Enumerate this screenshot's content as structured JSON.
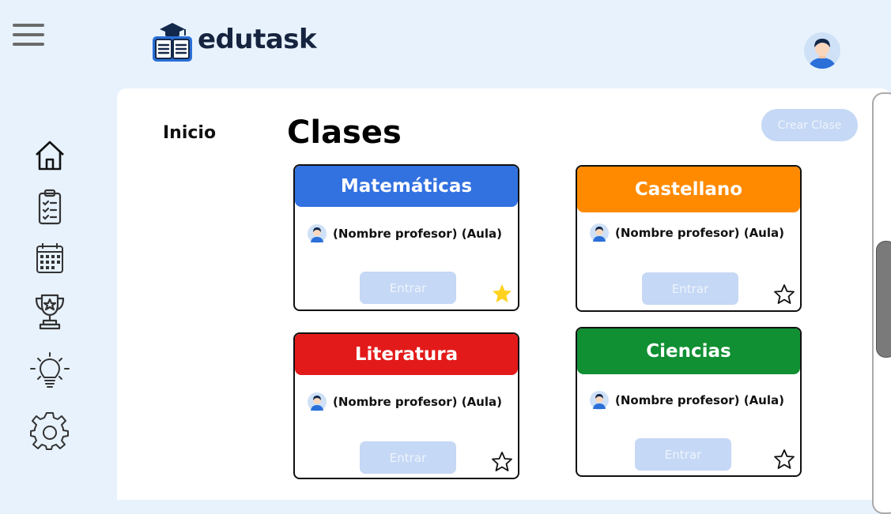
{
  "header": {
    "brand": "edutask",
    "menu_icon": "hamburger-icon",
    "logo_icon": "book-graduation-cap-icon",
    "avatar_icon": "user-avatar-icon"
  },
  "sidebar": {
    "items": [
      {
        "icon": "home-icon"
      },
      {
        "icon": "clipboard-checklist-icon"
      },
      {
        "icon": "calendar-icon"
      },
      {
        "icon": "trophy-icon"
      },
      {
        "icon": "lightbulb-icon"
      },
      {
        "icon": "gear-icon"
      }
    ]
  },
  "main": {
    "breadcrumb": "Inicio",
    "title": "Clases",
    "create_button": "Crear Clase"
  },
  "classes": [
    {
      "name": "Matemáticas",
      "color": "#3271e0",
      "teacher": "(Nombre profesor) (Aula)",
      "enter": "Entrar",
      "favorite": true
    },
    {
      "name": "Castellano",
      "color": "#ff8a00",
      "teacher": "(Nombre profesor) (Aula)",
      "enter": "Entrar",
      "favorite": false
    },
    {
      "name": "Literatura",
      "color": "#e31a1a",
      "teacher": "(Nombre profesor) (Aula)",
      "enter": "Entrar",
      "favorite": false
    },
    {
      "name": "Ciencias",
      "color": "#108f33",
      "teacher": "(Nombre profesor) (Aula)",
      "enter": "Entrar",
      "favorite": false
    }
  ]
}
